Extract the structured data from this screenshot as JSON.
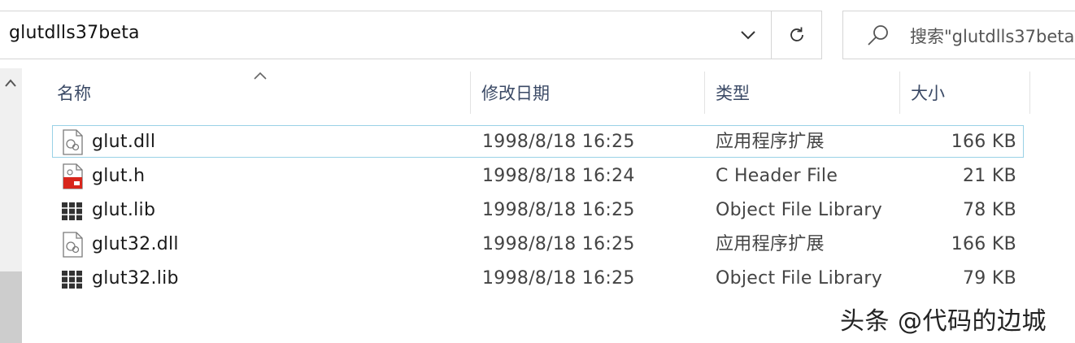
{
  "address_bar": {
    "path": "glutdlls37beta",
    "dropdown_icon": "chevron-down-icon",
    "refresh_icon": "refresh-icon"
  },
  "search": {
    "placeholder": "搜索\"glutdlls37beta\"",
    "icon": "search-icon"
  },
  "columns": {
    "name": "名称",
    "modified": "修改日期",
    "type": "类型",
    "size": "大小"
  },
  "files": [
    {
      "name": "glut.dll",
      "modified": "1998/8/18 16:25",
      "type": "应用程序扩展",
      "size": "166 KB",
      "icon": "dll-file-icon"
    },
    {
      "name": "glut.h",
      "modified": "1998/8/18 16:24",
      "type": "C Header File",
      "size": "21 KB",
      "icon": "header-file-icon"
    },
    {
      "name": "glut.lib",
      "modified": "1998/8/18 16:25",
      "type": "Object File Library",
      "size": "78 KB",
      "icon": "library-file-icon"
    },
    {
      "name": "glut32.dll",
      "modified": "1998/8/18 16:25",
      "type": "应用程序扩展",
      "size": "166 KB",
      "icon": "dll-file-icon"
    },
    {
      "name": "glut32.lib",
      "modified": "1998/8/18 16:25",
      "type": "Object File Library",
      "size": "79 KB",
      "icon": "library-file-icon"
    }
  ],
  "watermark": "头条 @代码的边城",
  "colors": {
    "focus_border": "#99d1e6",
    "header_text": "#3b4a66",
    "header_file_red": "#d8261c"
  }
}
